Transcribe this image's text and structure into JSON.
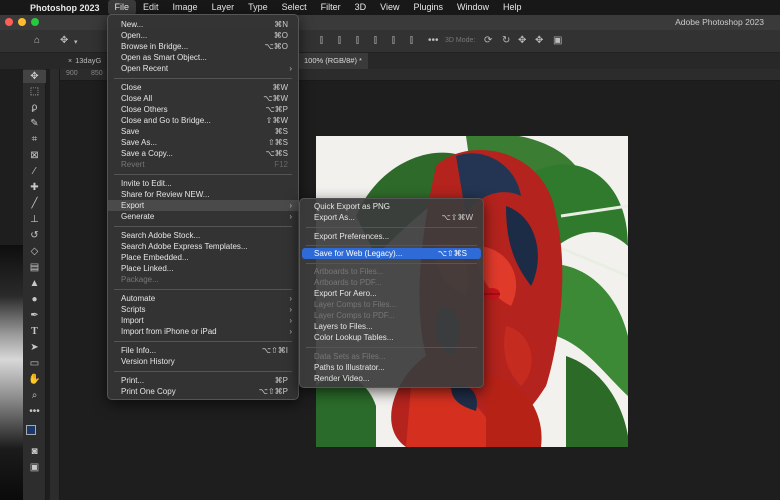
{
  "menubar": {
    "app": "Photoshop 2023",
    "items": [
      "File",
      "Edit",
      "Image",
      "Layer",
      "Type",
      "Select",
      "Filter",
      "3D",
      "View",
      "Plugins",
      "Window",
      "Help"
    ]
  },
  "window": {
    "title": "Adobe Photoshop 2023"
  },
  "options_bar": {
    "mode_3d": "3D Mode:"
  },
  "tabs": {
    "doc1": "13dayG",
    "doc2": "100% (RGB/8#) *"
  },
  "ruler": [
    "900",
    "850",
    "800"
  ],
  "file_menu": {
    "items": [
      {
        "label": "New...",
        "shortcut": "⌘N"
      },
      {
        "label": "Open...",
        "shortcut": "⌘O"
      },
      {
        "label": "Browse in Bridge...",
        "shortcut": "⌥⌘O"
      },
      {
        "label": "Open as Smart Object...",
        "shortcut": ""
      },
      {
        "label": "Open Recent",
        "shortcut": ""
      },
      {
        "label": "Close",
        "shortcut": "⌘W"
      },
      {
        "label": "Close All",
        "shortcut": "⌥⌘W"
      },
      {
        "label": "Close Others",
        "shortcut": "⌥⌘P"
      },
      {
        "label": "Close and Go to Bridge...",
        "shortcut": "⇧⌘W"
      },
      {
        "label": "Save",
        "shortcut": "⌘S"
      },
      {
        "label": "Save As...",
        "shortcut": "⇧⌘S"
      },
      {
        "label": "Save a Copy...",
        "shortcut": "⌥⌘S"
      },
      {
        "label": "Revert",
        "shortcut": "F12"
      },
      {
        "label": "Invite to Edit...",
        "shortcut": ""
      },
      {
        "label": "Share for Review NEW...",
        "shortcut": ""
      },
      {
        "label": "Export",
        "shortcut": ""
      },
      {
        "label": "Generate",
        "shortcut": ""
      },
      {
        "label": "Search Adobe Stock...",
        "shortcut": ""
      },
      {
        "label": "Search Adobe Express Templates...",
        "shortcut": ""
      },
      {
        "label": "Place Embedded...",
        "shortcut": ""
      },
      {
        "label": "Place Linked...",
        "shortcut": ""
      },
      {
        "label": "Package...",
        "shortcut": ""
      },
      {
        "label": "Automate",
        "shortcut": ""
      },
      {
        "label": "Scripts",
        "shortcut": ""
      },
      {
        "label": "Import",
        "shortcut": ""
      },
      {
        "label": "Import from iPhone or iPad",
        "shortcut": ""
      },
      {
        "label": "File Info...",
        "shortcut": "⌥⇧⌘I"
      },
      {
        "label": "Version History",
        "shortcut": ""
      },
      {
        "label": "Print...",
        "shortcut": "⌘P"
      },
      {
        "label": "Print One Copy",
        "shortcut": "⌥⇧⌘P"
      }
    ]
  },
  "export_menu": {
    "items": [
      {
        "label": "Quick Export as PNG",
        "shortcut": ""
      },
      {
        "label": "Export As...",
        "shortcut": "⌥⇧⌘W"
      },
      {
        "label": "Export Preferences...",
        "shortcut": ""
      },
      {
        "label": "Save for Web (Legacy)...",
        "shortcut": "⌥⇧⌘S"
      },
      {
        "label": "Artboards to Files...",
        "shortcut": ""
      },
      {
        "label": "Artboards to PDF...",
        "shortcut": ""
      },
      {
        "label": "Export For Aero...",
        "shortcut": ""
      },
      {
        "label": "Layer Comps to Files...",
        "shortcut": ""
      },
      {
        "label": "Layer Comps to PDF...",
        "shortcut": ""
      },
      {
        "label": "Layers to Files...",
        "shortcut": ""
      },
      {
        "label": "Color Lookup Tables...",
        "shortcut": ""
      },
      {
        "label": "Data Sets as Files...",
        "shortcut": ""
      },
      {
        "label": "Paths to Illustrator...",
        "shortcut": ""
      },
      {
        "label": "Render Video...",
        "shortcut": ""
      }
    ]
  },
  "colors": {
    "highlight": "#2e6bd6",
    "menu_bg": "#343434",
    "red_close": "#ff5f57",
    "yellow_min": "#febc2e",
    "green_max": "#28c840"
  }
}
